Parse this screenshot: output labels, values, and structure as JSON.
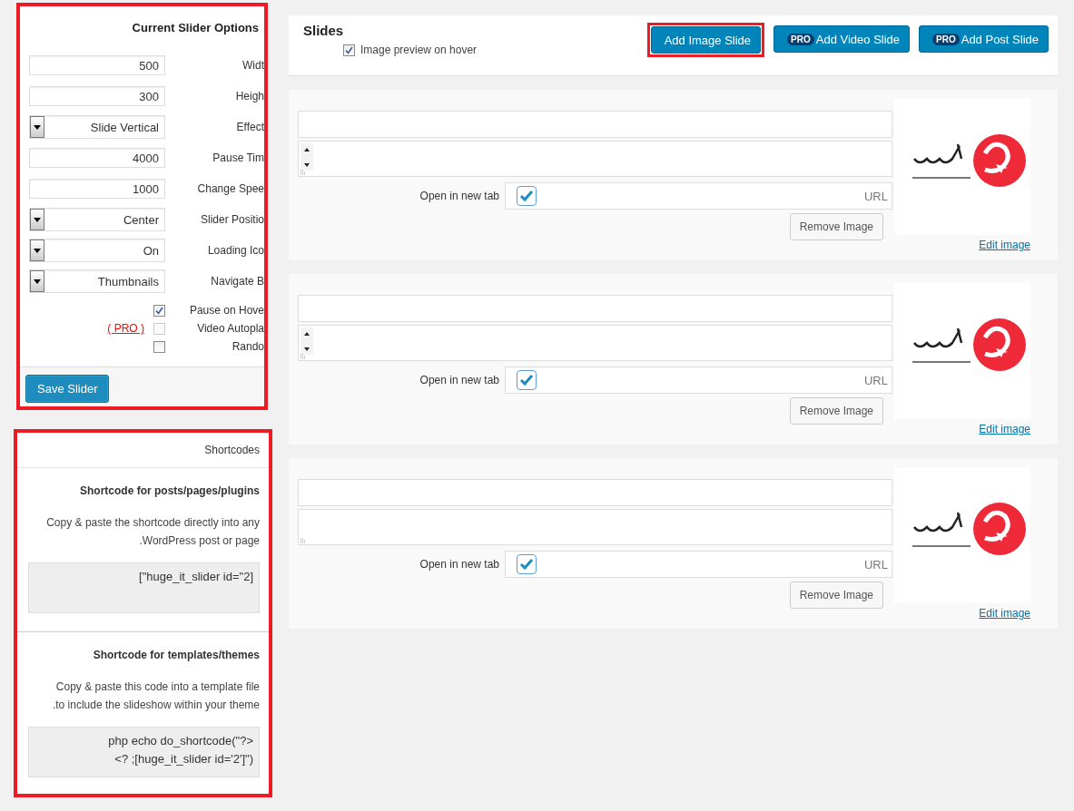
{
  "options_panel": {
    "title": "Current Slider Options",
    "fields": [
      {
        "kind": "text",
        "value": "500",
        "label": "Widt"
      },
      {
        "kind": "text",
        "value": "300",
        "label": "Heigh"
      },
      {
        "kind": "select",
        "value": "Slide Vertical",
        "label": "Effect"
      },
      {
        "kind": "text",
        "value": "4000",
        "label": "Pause Tim"
      },
      {
        "kind": "text",
        "value": "1000",
        "label": "Change Spee"
      },
      {
        "kind": "select",
        "value": "Center",
        "label": "Slider Positio"
      },
      {
        "kind": "select",
        "value": "On",
        "label": "Loading Ico"
      },
      {
        "kind": "select",
        "value": "Thumbnails",
        "label": "Navigate B"
      }
    ],
    "checkboxes": [
      {
        "label": "Pause on Hove",
        "checked": true,
        "disabled": false
      },
      {
        "label": "Video Autopla",
        "checked": false,
        "disabled": true,
        "pro_link": "( PRO )"
      },
      {
        "label": "Rando",
        "checked": false,
        "disabled": false
      }
    ],
    "save_button": "Save Slider"
  },
  "shortcodes_panel": {
    "title": "Shortcodes",
    "sections": [
      {
        "heading": "Shortcode for posts/pages/plugins",
        "description_lines": [
          "Copy & paste the shortcode directly into any",
          ".WordPress post or page"
        ],
        "code_lines": [
          "[\"huge_it_slider id=\"2]"
        ]
      },
      {
        "heading": "Shortcode for templates/themes",
        "description_lines": [
          "Copy & paste this code into a template file",
          ".to include the slideshow within your theme"
        ],
        "code_lines": [
          "php echo do_shortcode(\"?>",
          "<? ;[huge_it_slider id='2']\")"
        ]
      }
    ]
  },
  "slides_header": {
    "title": "Slides",
    "preview_checkbox": {
      "label": "Image preview on hover",
      "checked": true
    },
    "buttons": [
      {
        "label": "Add Image Slide",
        "highlighted": true
      },
      {
        "label": "Add Video Slide",
        "pro_badge": "PRO",
        "highlighted": false
      },
      {
        "label": "Add Post Slide",
        "pro_badge": "PRO",
        "highlighted": false
      }
    ]
  },
  "slides": [
    {
      "scroll_arrows": true,
      "open_label": "Open in new tab",
      "open_checked": true,
      "url_placeholder": "URL",
      "remove_button": "Remove Image",
      "edit_link": "Edit image"
    },
    {
      "scroll_arrows": true,
      "open_label": "Open in new tab",
      "open_checked": true,
      "url_placeholder": "URL",
      "remove_button": "Remove Image",
      "edit_link": "Edit image"
    },
    {
      "scroll_arrows": false,
      "open_label": "Open in new tab",
      "open_checked": true,
      "url_placeholder": "URL",
      "remove_button": "Remove Image",
      "edit_link": "Edit image"
    }
  ]
}
